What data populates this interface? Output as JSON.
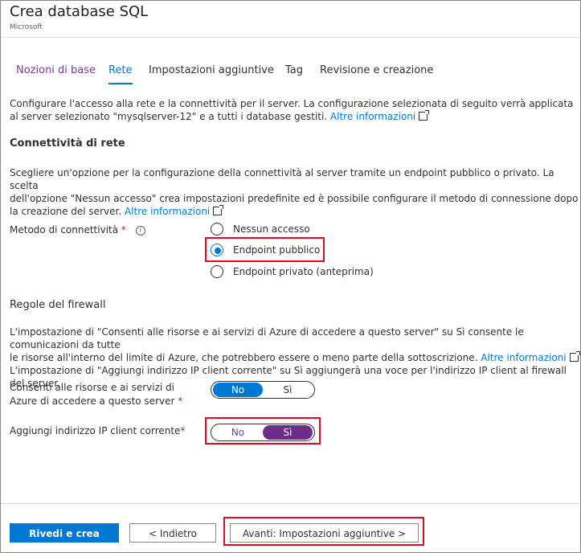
{
  "window": {
    "title": "Crea database SQL",
    "publisher": "Microsoft"
  },
  "tabs": [
    {
      "label": "Nozioni di base"
    },
    {
      "label": "Rete",
      "active": true
    },
    {
      "label": "Impostazioni aggiuntive"
    },
    {
      "label": "Tag"
    },
    {
      "label": "Revisione e creazione"
    }
  ],
  "intro": {
    "line1": "Configurare l'accesso alla rete e la connettività per il server. La configurazione selezionata di seguito verrà applicata",
    "line2": "al server selezionato \"mysqlserver-12\" e a tutti i database gestiti.",
    "link": "Altre informazioni"
  },
  "network_section": {
    "heading": "Connettività di rete",
    "line1": "Scegliere un'opzione per la configurazione della connettività al server tramite un endpoint pubblico o privato. La scelta",
    "line2": "dell'opzione \"Nessun accesso\" crea impostazioni predefinite ed è possibile configurare il metodo di connessione dopo",
    "line3": "la creazione del server.",
    "link": "Altre informazioni"
  },
  "connectivity": {
    "label": "Metodo di connettività",
    "required": "*",
    "info_icon": "info-icon",
    "options": [
      {
        "label": "Nessun accesso",
        "selected": false
      },
      {
        "label": "Endpoint pubblico",
        "selected": true
      },
      {
        "label": "Endpoint privato (anteprima)",
        "selected": false
      }
    ]
  },
  "firewall": {
    "heading": "Regole del firewall",
    "line1": "L'impostazione di \"Consenti alle risorse e ai servizi di Azure di accedere a questo server\" su Sì consente le comunicazioni da tutte",
    "line2": "le risorse all'interno del limite di Azure, che potrebbero essere o meno parte della sottoscrizione.",
    "link": "Altre informazioni",
    "line3": "L'impostazione di \"Aggiungi indirizzo IP client corrente\" su Sì aggiungerà una voce per l'indirizzo IP client al firewall del server."
  },
  "allow_azure": {
    "label_line1": "Consenti alle risorse e ai servizi di",
    "label_line2": "Azure di accedere a questo server",
    "required": "*",
    "no": "No",
    "yes": "Sì",
    "value": "No"
  },
  "add_client_ip": {
    "label": "Aggiungi indirizzo IP client corrente",
    "required": "*",
    "no": "No",
    "yes": "Sì",
    "value": "Sì"
  },
  "footer": {
    "review_create": "Rivedi e crea",
    "back": "< Indietro",
    "next": "Avanti: Impostazioni aggiuntive >"
  },
  "colors": {
    "accent": "#0078d4",
    "visited_tab": "#773b93",
    "toggle_purple": "#6b2f8a",
    "highlight": "#e00b1c",
    "required": "#a4262c"
  }
}
